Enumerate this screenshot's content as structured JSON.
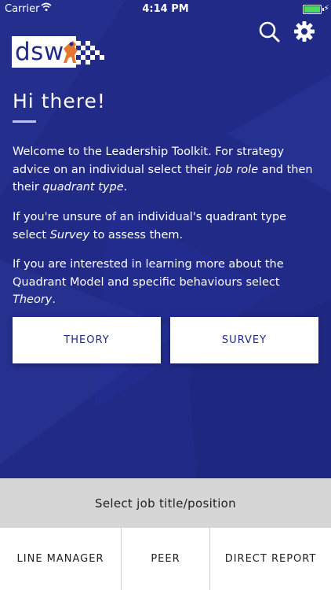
{
  "status_bar": {
    "carrier": "Carrier",
    "time": "4:14 PM",
    "wifi_icon": "wifi-icon",
    "battery_icon": "battery-icon"
  },
  "logo": {
    "text": "dsw"
  },
  "header": {
    "search_icon": "search-icon",
    "settings_icon": "gear-icon"
  },
  "greeting": "Hi there!",
  "intro": {
    "p1_a": "Welcome to the ",
    "p1_toolkit": "Leadership Toolkit",
    "p1_b": ". For strategy advice on an individual select their ",
    "p1_jobrole": "job role",
    "p1_c": " and then their ",
    "p1_quadrant": "quadrant type",
    "p1_d": ".",
    "p2_a": "If you're unsure of an individual's quadrant type select ",
    "p2_survey": "Survey",
    "p2_b": " to assess them.",
    "p3_a": "If you are interested in learning more about the Quadrant Model and specific behaviours select ",
    "p3_theory": "Theory",
    "p3_b": "."
  },
  "buttons": {
    "theory": "THEORY",
    "survey": "SURVEY"
  },
  "select_bar": "Select job title/position",
  "tabs": [
    "LINE MANAGER",
    "PEER",
    "DIRECT REPORT"
  ],
  "colors": {
    "brand_blue": "#1f2a8c",
    "white": "#ffffff",
    "grey_bar": "#d6d6d6",
    "battery_green": "#4cd964",
    "logo_orange": "#e8772e"
  }
}
